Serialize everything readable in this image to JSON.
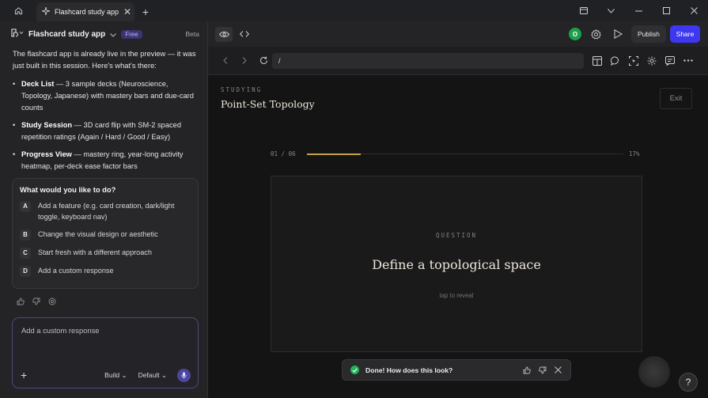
{
  "browser": {
    "tab_title": "Flashcard study app"
  },
  "appbar": {
    "app_name": "Flashcard study app",
    "plan_badge": "Free",
    "beta_label": "Beta"
  },
  "chat": {
    "intro": "The flashcard app is already live in the preview — it was just built in this session. Here's what's there:",
    "features": [
      {
        "title": "Deck List",
        "desc": " — 3 sample decks (Neuroscience, Topology, Japanese) with mastery bars and due-card counts"
      },
      {
        "title": "Study Session",
        "desc": " — 3D card flip with SM-2 spaced repetition ratings (Again / Hard / Good / Easy)"
      },
      {
        "title": "Progress View",
        "desc": " — mastery ring, year-long activity heatmap, per-deck ease factor bars"
      }
    ]
  },
  "prompt": {
    "question": "What would you like to do?",
    "options": [
      {
        "key": "A",
        "label": "Add a feature (e.g. card creation, dark/light toggle, keyboard nav)"
      },
      {
        "key": "B",
        "label": "Change the visual design or aesthetic"
      },
      {
        "key": "C",
        "label": "Start fresh with a different approach"
      },
      {
        "key": "D",
        "label": "Add a custom response"
      }
    ]
  },
  "composer": {
    "placeholder": "Add a custom response",
    "mode": "Build",
    "model": "Default"
  },
  "header": {
    "avatar_initial": "O",
    "publish_label": "Publish",
    "share_label": "Share"
  },
  "preview_bar": {
    "url": "/"
  },
  "study": {
    "label": "STUDYING",
    "deck_title": "Point-Set Topology",
    "exit_label": "Exit",
    "counter": "01 / 06",
    "percent_text": "17%",
    "progress": 0.17,
    "question_label": "QUESTION",
    "question": "Define a topological space",
    "hint": "tap to reveal"
  },
  "toast": {
    "message": "Done! How does this look?"
  },
  "help_label": "?",
  "colors": {
    "accent": "#3d37f0",
    "progress_fill": "#c7a24e",
    "success": "#22b35a"
  }
}
